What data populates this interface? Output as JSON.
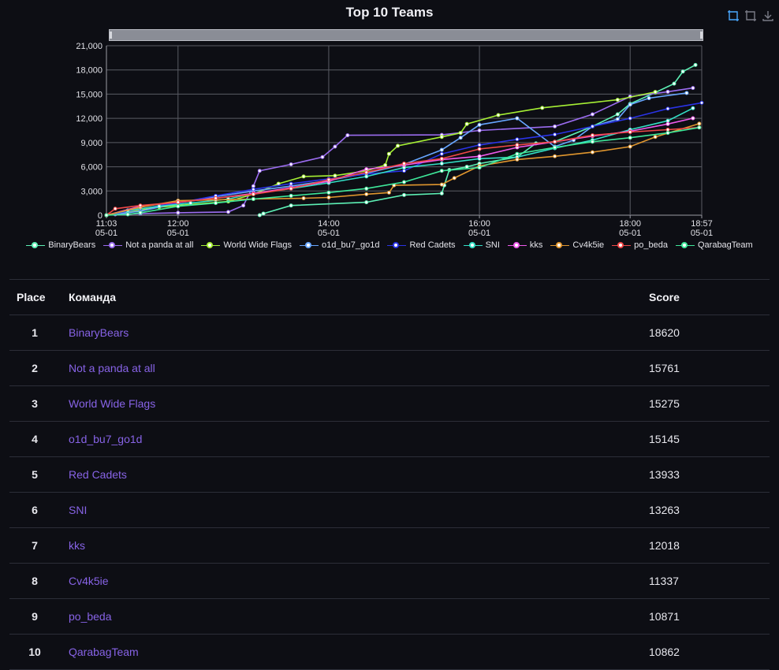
{
  "page": {
    "title": "Top 10 Teams"
  },
  "toolbox": {
    "icons": [
      "zoom-icon",
      "zoom-reset-icon",
      "download-icon"
    ]
  },
  "chart_data": {
    "type": "line",
    "title": "Top 10 Teams",
    "xlabel": "",
    "ylabel": "",
    "x_ticks": [
      "11:03\n05-01",
      "12:00\n05-01",
      "14:00\n05-01",
      "16:00\n05-01",
      "18:00\n05-01",
      "18:57\n05-01"
    ],
    "x_range": [
      "11:03",
      "18:57"
    ],
    "ylim": [
      0,
      21000
    ],
    "y_ticks": [
      "0",
      "3,000",
      "6,000",
      "9,000",
      "12,000",
      "15,000",
      "18,000",
      "21,000"
    ],
    "grid": true,
    "legend_position": "bottom",
    "series": [
      {
        "name": "BinaryBears",
        "color": "#5df0b5",
        "points": [
          [
            "13:05",
            0
          ],
          [
            "13:08",
            200
          ],
          [
            "13:30",
            1200
          ],
          [
            "14:30",
            1600
          ],
          [
            "15:00",
            2500
          ],
          [
            "15:30",
            2700
          ],
          [
            "15:32",
            3700
          ],
          [
            "15:36",
            5600
          ],
          [
            "15:50",
            6000
          ],
          [
            "16:00",
            6400
          ],
          [
            "16:30",
            7200
          ],
          [
            "16:45",
            8900
          ],
          [
            "17:00",
            9100
          ],
          [
            "17:30",
            11000
          ],
          [
            "17:50",
            12500
          ],
          [
            "18:00",
            13800
          ],
          [
            "18:20",
            15200
          ],
          [
            "18:35",
            16300
          ],
          [
            "18:42",
            17800
          ],
          [
            "18:52",
            18620
          ]
        ]
      },
      {
        "name": "Not a panda at all",
        "color": "#9b6cf0",
        "points": [
          [
            "11:10",
            100
          ],
          [
            "11:30",
            200
          ],
          [
            "12:00",
            300
          ],
          [
            "12:40",
            400
          ],
          [
            "12:52",
            1200
          ],
          [
            "13:00",
            3600
          ],
          [
            "13:05",
            5500
          ],
          [
            "13:30",
            6300
          ],
          [
            "13:55",
            7200
          ],
          [
            "14:05",
            8500
          ],
          [
            "14:15",
            9900
          ],
          [
            "15:30",
            9950
          ],
          [
            "16:00",
            10500
          ],
          [
            "17:00",
            11000
          ],
          [
            "17:30",
            12500
          ],
          [
            "18:00",
            14700
          ],
          [
            "18:30",
            15300
          ],
          [
            "18:50",
            15761
          ]
        ]
      },
      {
        "name": "World Wide Flags",
        "color": "#a6f034",
        "points": [
          [
            "11:03",
            0
          ],
          [
            "11:20",
            400
          ],
          [
            "11:45",
            1000
          ],
          [
            "12:00",
            1200
          ],
          [
            "12:40",
            1700
          ],
          [
            "13:00",
            2600
          ],
          [
            "13:20",
            3900
          ],
          [
            "13:40",
            4800
          ],
          [
            "14:05",
            4900
          ],
          [
            "14:30",
            5500
          ],
          [
            "14:45",
            6200
          ],
          [
            "14:48",
            7600
          ],
          [
            "14:55",
            8600
          ],
          [
            "15:30",
            9700
          ],
          [
            "15:45",
            10200
          ],
          [
            "15:50",
            11300
          ],
          [
            "16:15",
            12400
          ],
          [
            "16:50",
            13300
          ],
          [
            "17:50",
            14300
          ],
          [
            "18:20",
            15275
          ]
        ]
      },
      {
        "name": "o1d_bu7_go1d",
        "color": "#67a6ff",
        "points": [
          [
            "11:03",
            0
          ],
          [
            "11:30",
            500
          ],
          [
            "12:00",
            1500
          ],
          [
            "12:30",
            2300
          ],
          [
            "13:00",
            3000
          ],
          [
            "13:30",
            3600
          ],
          [
            "14:00",
            4300
          ],
          [
            "14:30",
            5200
          ],
          [
            "15:00",
            6300
          ],
          [
            "15:30",
            8100
          ],
          [
            "15:45",
            9600
          ],
          [
            "16:00",
            11200
          ],
          [
            "16:30",
            12000
          ],
          [
            "17:00",
            8500
          ],
          [
            "17:15",
            9300
          ],
          [
            "17:30",
            11000
          ],
          [
            "17:50",
            11900
          ],
          [
            "18:00",
            13700
          ],
          [
            "18:15",
            14500
          ],
          [
            "18:45",
            15145
          ]
        ]
      },
      {
        "name": "Red Cadets",
        "color": "#2a33e6",
        "points": [
          [
            "11:03",
            0
          ],
          [
            "11:30",
            800
          ],
          [
            "12:00",
            1500
          ],
          [
            "12:30",
            2400
          ],
          [
            "13:00",
            3200
          ],
          [
            "13:30",
            3900
          ],
          [
            "14:00",
            4500
          ],
          [
            "14:30",
            5100
          ],
          [
            "15:00",
            5500
          ],
          [
            "15:30",
            7600
          ],
          [
            "16:00",
            8700
          ],
          [
            "16:30",
            9400
          ],
          [
            "17:00",
            10000
          ],
          [
            "17:30",
            11000
          ],
          [
            "18:00",
            12000
          ],
          [
            "18:30",
            13200
          ],
          [
            "18:57",
            13933
          ]
        ]
      },
      {
        "name": "SNI",
        "color": "#33e0c6",
        "points": [
          [
            "11:03",
            0
          ],
          [
            "11:20",
            600
          ],
          [
            "11:45",
            1100
          ],
          [
            "12:10",
            1500
          ],
          [
            "12:40",
            2000
          ],
          [
            "13:00",
            2700
          ],
          [
            "13:30",
            3300
          ],
          [
            "14:00",
            4000
          ],
          [
            "14:30",
            4800
          ],
          [
            "15:00",
            5900
          ],
          [
            "15:30",
            6400
          ],
          [
            "16:00",
            7000
          ],
          [
            "16:30",
            7200
          ],
          [
            "17:00",
            8300
          ],
          [
            "17:30",
            9300
          ],
          [
            "18:00",
            10600
          ],
          [
            "18:30",
            11700
          ],
          [
            "18:50",
            13263
          ]
        ]
      },
      {
        "name": "kks",
        "color": "#ef5aec",
        "points": [
          [
            "11:03",
            0
          ],
          [
            "11:30",
            1100
          ],
          [
            "12:00",
            1600
          ],
          [
            "12:30",
            2100
          ],
          [
            "13:00",
            2700
          ],
          [
            "13:30",
            3400
          ],
          [
            "14:00",
            4200
          ],
          [
            "14:30",
            5700
          ],
          [
            "15:00",
            6200
          ],
          [
            "15:30",
            6900
          ],
          [
            "16:00",
            7300
          ],
          [
            "16:30",
            8400
          ],
          [
            "17:00",
            9100
          ],
          [
            "17:30",
            9800
          ],
          [
            "18:00",
            10400
          ],
          [
            "18:30",
            11300
          ],
          [
            "18:50",
            12018
          ]
        ]
      },
      {
        "name": "Cv4k5ie",
        "color": "#e0962e",
        "points": [
          [
            "11:03",
            0
          ],
          [
            "11:30",
            1000
          ],
          [
            "12:00",
            1800
          ],
          [
            "12:30",
            1900
          ],
          [
            "13:00",
            2000
          ],
          [
            "13:40",
            2100
          ],
          [
            "14:00",
            2200
          ],
          [
            "14:30",
            2600
          ],
          [
            "14:48",
            2800
          ],
          [
            "14:52",
            3700
          ],
          [
            "15:30",
            3800
          ],
          [
            "15:40",
            4600
          ],
          [
            "16:00",
            6100
          ],
          [
            "16:30",
            6900
          ],
          [
            "17:00",
            7300
          ],
          [
            "17:30",
            7800
          ],
          [
            "18:00",
            8500
          ],
          [
            "18:20",
            9700
          ],
          [
            "18:55",
            11337
          ]
        ]
      },
      {
        "name": "po_beda",
        "color": "#f04848",
        "points": [
          [
            "11:03",
            0
          ],
          [
            "11:10",
            800
          ],
          [
            "11:30",
            1200
          ],
          [
            "12:00",
            1600
          ],
          [
            "12:30",
            2100
          ],
          [
            "13:00",
            2600
          ],
          [
            "13:30",
            3300
          ],
          [
            "14:00",
            4400
          ],
          [
            "14:30",
            5300
          ],
          [
            "15:00",
            6400
          ],
          [
            "15:30",
            7000
          ],
          [
            "16:00",
            8200
          ],
          [
            "16:30",
            8700
          ],
          [
            "17:00",
            9100
          ],
          [
            "17:30",
            9900
          ],
          [
            "18:00",
            10300
          ],
          [
            "18:30",
            10600
          ],
          [
            "18:55",
            10871
          ]
        ]
      },
      {
        "name": "QarabagTeam",
        "color": "#3ee89a",
        "points": [
          [
            "11:03",
            0
          ],
          [
            "11:20",
            100
          ],
          [
            "11:30",
            300
          ],
          [
            "12:00",
            1100
          ],
          [
            "12:30",
            1500
          ],
          [
            "13:00",
            2000
          ],
          [
            "13:30",
            2400
          ],
          [
            "14:00",
            2800
          ],
          [
            "14:30",
            3300
          ],
          [
            "15:00",
            4100
          ],
          [
            "15:30",
            5500
          ],
          [
            "16:00",
            5900
          ],
          [
            "16:30",
            7600
          ],
          [
            "17:00",
            8400
          ],
          [
            "17:30",
            9100
          ],
          [
            "18:00",
            9600
          ],
          [
            "18:30",
            10200
          ],
          [
            "18:55",
            10862
          ]
        ]
      }
    ]
  },
  "table": {
    "headers": {
      "place": "Place",
      "team": "Команда",
      "score": "Score"
    },
    "rows": [
      {
        "place": "1",
        "team": "BinaryBears",
        "score": "18620"
      },
      {
        "place": "2",
        "team": "Not a panda at all",
        "score": "15761"
      },
      {
        "place": "3",
        "team": "World Wide Flags",
        "score": "15275"
      },
      {
        "place": "4",
        "team": "o1d_bu7_go1d",
        "score": "15145"
      },
      {
        "place": "5",
        "team": "Red Cadets",
        "score": "13933"
      },
      {
        "place": "6",
        "team": "SNI",
        "score": "13263"
      },
      {
        "place": "7",
        "team": "kks",
        "score": "12018"
      },
      {
        "place": "8",
        "team": "Cv4k5ie",
        "score": "11337"
      },
      {
        "place": "9",
        "team": "po_beda",
        "score": "10871"
      },
      {
        "place": "10",
        "team": "QarabagTeam",
        "score": "10862"
      }
    ]
  }
}
